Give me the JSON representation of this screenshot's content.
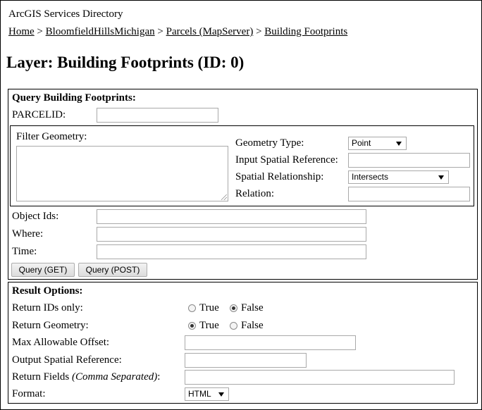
{
  "header": {
    "app_title": "ArcGIS Services Directory",
    "breadcrumbs": [
      {
        "label": "Home"
      },
      {
        "label": "BloomfieldHillsMichigan"
      },
      {
        "label": "Parcels (MapServer)"
      },
      {
        "label": "Building Footprints"
      }
    ],
    "separator": ">",
    "page_title": "Layer: Building Footprints (ID: 0)"
  },
  "query": {
    "title": "Query Building Footprints:",
    "parcelid_label": "PARCELID:",
    "parcelid_value": "",
    "filter_geometry_label": "Filter Geometry:",
    "filter_geometry_value": "",
    "geometry_type_label": "Geometry Type:",
    "geometry_type_value": "Point",
    "input_sr_label": "Input Spatial Reference:",
    "input_sr_value": "",
    "spatial_rel_label": "Spatial Relationship:",
    "spatial_rel_value": "Intersects",
    "relation_label": "Relation:",
    "relation_value": "",
    "object_ids_label": "Object Ids:",
    "object_ids_value": "",
    "where_label": "Where:",
    "where_value": "",
    "time_label": "Time:",
    "time_value": "",
    "get_button": "Query (GET)",
    "post_button": "Query (POST)"
  },
  "results": {
    "title": "Result Options:",
    "return_ids_label": "Return IDs only:",
    "return_ids_true": "True",
    "return_ids_false": "False",
    "return_ids_selected": "False",
    "return_geometry_label": "Return Geometry:",
    "return_geometry_true": "True",
    "return_geometry_false": "False",
    "return_geometry_selected": "True",
    "max_offset_label": "Max Allowable Offset:",
    "max_offset_value": "",
    "output_sr_label": "Output Spatial Reference:",
    "output_sr_value": "",
    "return_fields_label": "Return Fields",
    "return_fields_note": "(Comma Separated)",
    "return_fields_colon": ":",
    "return_fields_value": "",
    "format_label": "Format:",
    "format_value": "HTML"
  }
}
